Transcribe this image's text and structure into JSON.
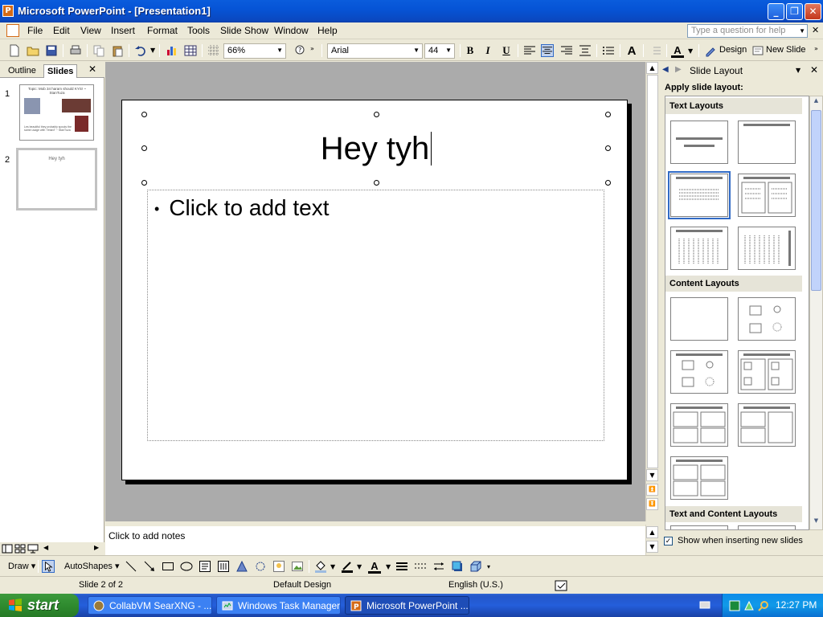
{
  "window": {
    "title": "Microsoft PowerPoint - [Presentation1]",
    "app_icon_letter": "P"
  },
  "menu": {
    "items": [
      "File",
      "Edit",
      "View",
      "Insert",
      "Format",
      "Tools",
      "Slide Show",
      "Window",
      "Help"
    ],
    "help_placeholder": "Type a question for help"
  },
  "toolbar": {
    "zoom": "66%",
    "font": "Arial",
    "font_size": "44",
    "bold": "B",
    "italic": "I",
    "underline": "U",
    "design_label": "Design",
    "new_slide_label": "New Slide"
  },
  "left_pane": {
    "tabs": [
      "Outline",
      "Slides"
    ],
    "active_tab": "Slides",
    "slides": [
      {
        "number": "1",
        "title": "Topic: Mob 34 haram should KYS! ~ StanTuza",
        "body": "Les beautiful they probably spouts the same usage with \"retard\" ~ StanTuza"
      },
      {
        "number": "2",
        "title": "Hey tyh"
      }
    ]
  },
  "slide": {
    "title": "Hey tyh",
    "body_placeholder": "Click to add text",
    "bullet": "•"
  },
  "notes": {
    "placeholder": "Click to add notes"
  },
  "task_pane": {
    "title": "Slide Layout",
    "apply_label": "Apply slide layout:",
    "sections": [
      "Text Layouts",
      "Content Layouts",
      "Text and Content Layouts"
    ],
    "show_when_label": "Show when inserting new slides",
    "show_when_checked": true
  },
  "drawing_toolbar": {
    "draw_label": "Draw",
    "autoshapes_label": "AutoShapes"
  },
  "status": {
    "slide_of": "Slide 2 of 2",
    "design": "Default Design",
    "language": "English (U.S.)"
  },
  "taskbar": {
    "start_label": "start",
    "tasks": [
      {
        "label": "CollabVM SearXNG - ...",
        "active": false
      },
      {
        "label": "Windows Task Manager",
        "active": false
      },
      {
        "label": "Microsoft PowerPoint ...",
        "active": true
      }
    ],
    "clock": "12:27 PM"
  },
  "colors": {
    "titlebar": "#0654d6",
    "chrome": "#ece9d8",
    "slide_area": "#ababab",
    "selection": "#316ac5",
    "taskbar": "#245edb",
    "start": "#2f8b2f"
  }
}
